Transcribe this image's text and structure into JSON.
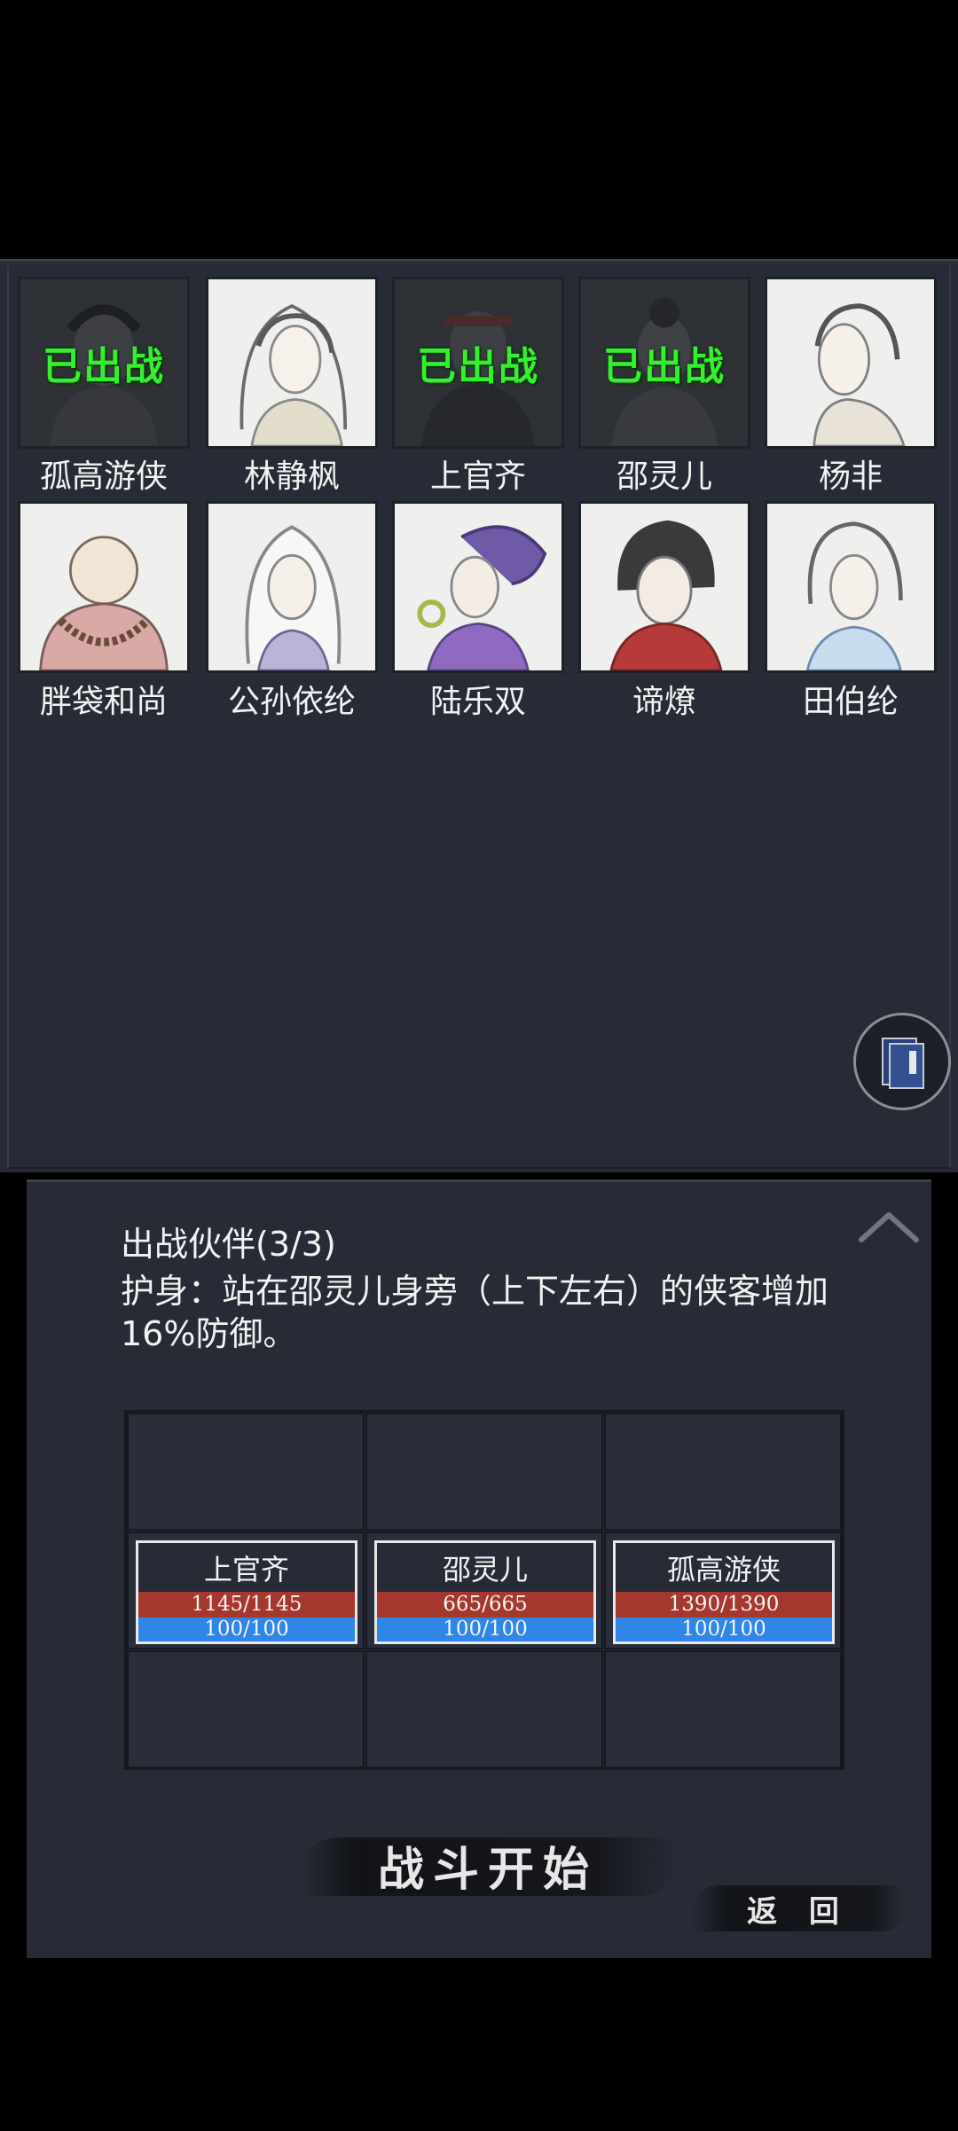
{
  "roster": {
    "characters": [
      {
        "name": "孤高游侠",
        "deployed_label": "已出战"
      },
      {
        "name": "林静枫",
        "deployed_label": ""
      },
      {
        "name": "上官齐",
        "deployed_label": "已出战"
      },
      {
        "name": "邵灵儿",
        "deployed_label": "已出战"
      },
      {
        "name": "杨非",
        "deployed_label": ""
      },
      {
        "name": "胖袋和尚",
        "deployed_label": ""
      },
      {
        "name": "公孙依纶",
        "deployed_label": ""
      },
      {
        "name": "陆乐双",
        "deployed_label": ""
      },
      {
        "name": "谛燎",
        "deployed_label": ""
      },
      {
        "name": "田伯纶",
        "deployed_label": ""
      }
    ]
  },
  "party": {
    "title": "出战伙伴(3/3)",
    "buff_description": "护身：站在邵灵儿身旁（上下左右）的侠客增加16%防御。"
  },
  "formation": {
    "units": [
      {
        "name": "上官齐",
        "hp": "1145/1145",
        "mp": "100/100"
      },
      {
        "name": "邵灵儿",
        "hp": "665/665",
        "mp": "100/100"
      },
      {
        "name": "孤高游侠",
        "hp": "1390/1390",
        "mp": "100/100"
      }
    ]
  },
  "buttons": {
    "start_battle": "战斗开始",
    "back": "返 回"
  },
  "icons": {
    "collapse": "chevron-up-icon",
    "book": "book-icon"
  },
  "colors": {
    "deployed_label": "#35f02e",
    "hp_bar": "#a5382e",
    "mp_bar": "#2f86e7",
    "panel_bg": "#262b36"
  }
}
